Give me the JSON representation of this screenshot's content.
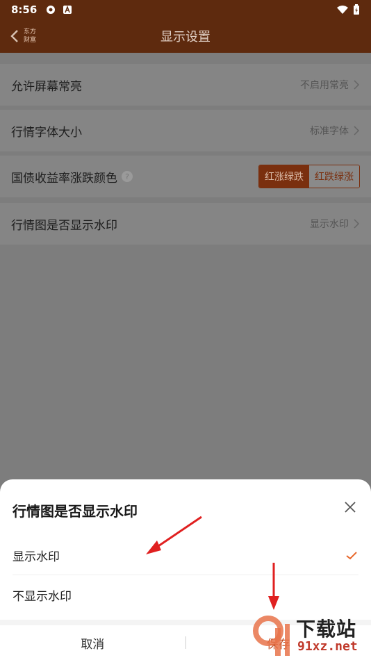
{
  "status": {
    "time": "8:56"
  },
  "appbar": {
    "title": "显示设置",
    "logo_text": "东方财富"
  },
  "settings": [
    {
      "label": "允许屏幕常亮",
      "value": "不启用常亮"
    },
    {
      "label": "行情字体大小",
      "value": "标准字体"
    },
    {
      "label": "国债收益率涨跌颜色",
      "option_a": "红涨绿跌",
      "option_b": "红跌绿涨",
      "selected": "红涨绿跌"
    },
    {
      "label": "行情图是否显示水印",
      "value": "显示水印"
    }
  ],
  "sheet": {
    "title": "行情图是否显示水印",
    "options": [
      "显示水印",
      "不显示水印"
    ],
    "selected": "显示水印",
    "cancel": "取消",
    "save": "保存"
  },
  "watermark": {
    "cn": "下载站",
    "url": "91xz.net"
  },
  "colors": {
    "bar": "#5e2a0e",
    "accent": "#c0471a",
    "arrow": "#e02020"
  }
}
